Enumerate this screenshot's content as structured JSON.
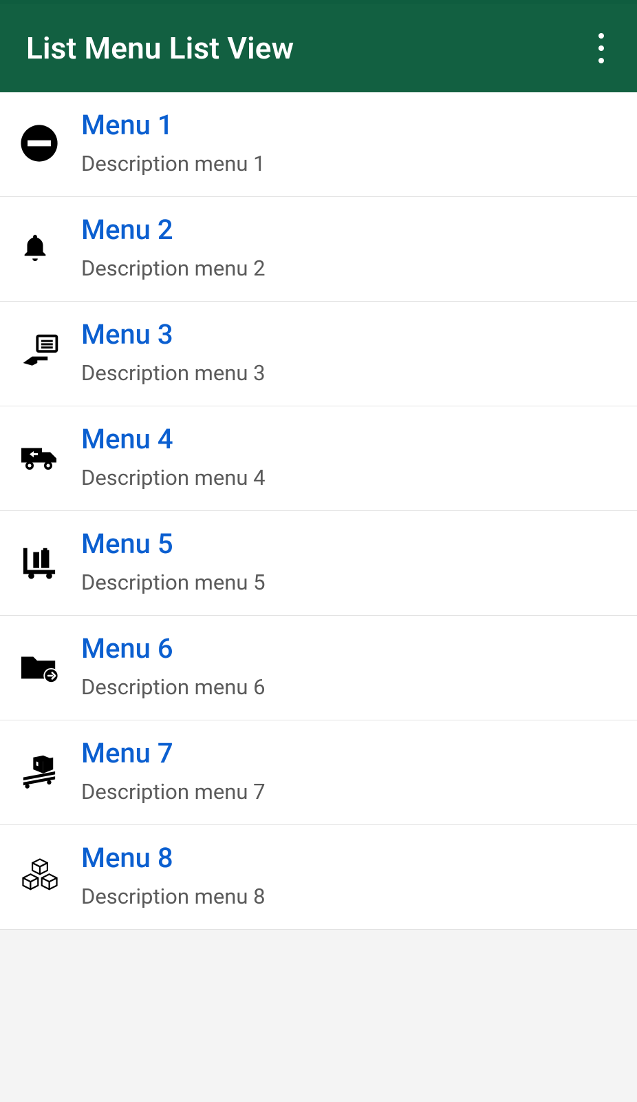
{
  "header": {
    "title": "List Menu List View"
  },
  "menu": {
    "items": [
      {
        "title": "Menu 1",
        "description": "Description menu 1",
        "icon": "no-entry-icon"
      },
      {
        "title": "Menu 2",
        "description": "Description menu 2",
        "icon": "bell-icon"
      },
      {
        "title": "Menu 3",
        "description": "Description menu 3",
        "icon": "hand-list-icon"
      },
      {
        "title": "Menu 4",
        "description": "Description menu 4",
        "icon": "return-truck-icon"
      },
      {
        "title": "Menu 5",
        "description": "Description menu 5",
        "icon": "luggage-cart-icon"
      },
      {
        "title": "Menu 6",
        "description": "Description menu 6",
        "icon": "folder-arrow-icon"
      },
      {
        "title": "Menu 7",
        "description": "Description menu 7",
        "icon": "pallet-box-icon"
      },
      {
        "title": "Menu 8",
        "description": "Description menu 8",
        "icon": "cubes-icon"
      }
    ]
  },
  "colors": {
    "primary": "#126041",
    "titleLink": "#0b5fd0",
    "descText": "#5a5a5a"
  }
}
